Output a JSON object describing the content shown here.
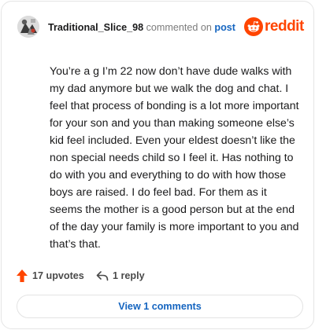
{
  "comment": {
    "username": "Traditional_Slice_98",
    "action_text": "commented on",
    "post_link": "post",
    "body": "You’re a g I’m 22 now don’t have dude walks with my dad anymore but we walk the dog and chat. I feel that process of bonding is a lot more important for your son and you than making someone else’s kid feel included. Even your eldest doesn’t like the non special needs child so I feel it. Has nothing to do with you and everything to do with how those boys are raised. I do feel bad. For them as it seems the mother is a good person but at the end of the day your family is more important to you and that’s that."
  },
  "brand": {
    "wordmark": "reddit",
    "icon": "reddit-alien-icon",
    "color": "#ff4500"
  },
  "actions": {
    "upvotes_label": "17 upvotes",
    "upvote_icon": "upvote-arrow-icon",
    "reply_label": "1 reply",
    "reply_icon": "reply-arrow-icon"
  },
  "footer": {
    "view_comments_label": "View 1 comments"
  },
  "colors": {
    "link": "#1565c0",
    "upvote": "#ff4500",
    "muted": "#7c7c7c"
  }
}
